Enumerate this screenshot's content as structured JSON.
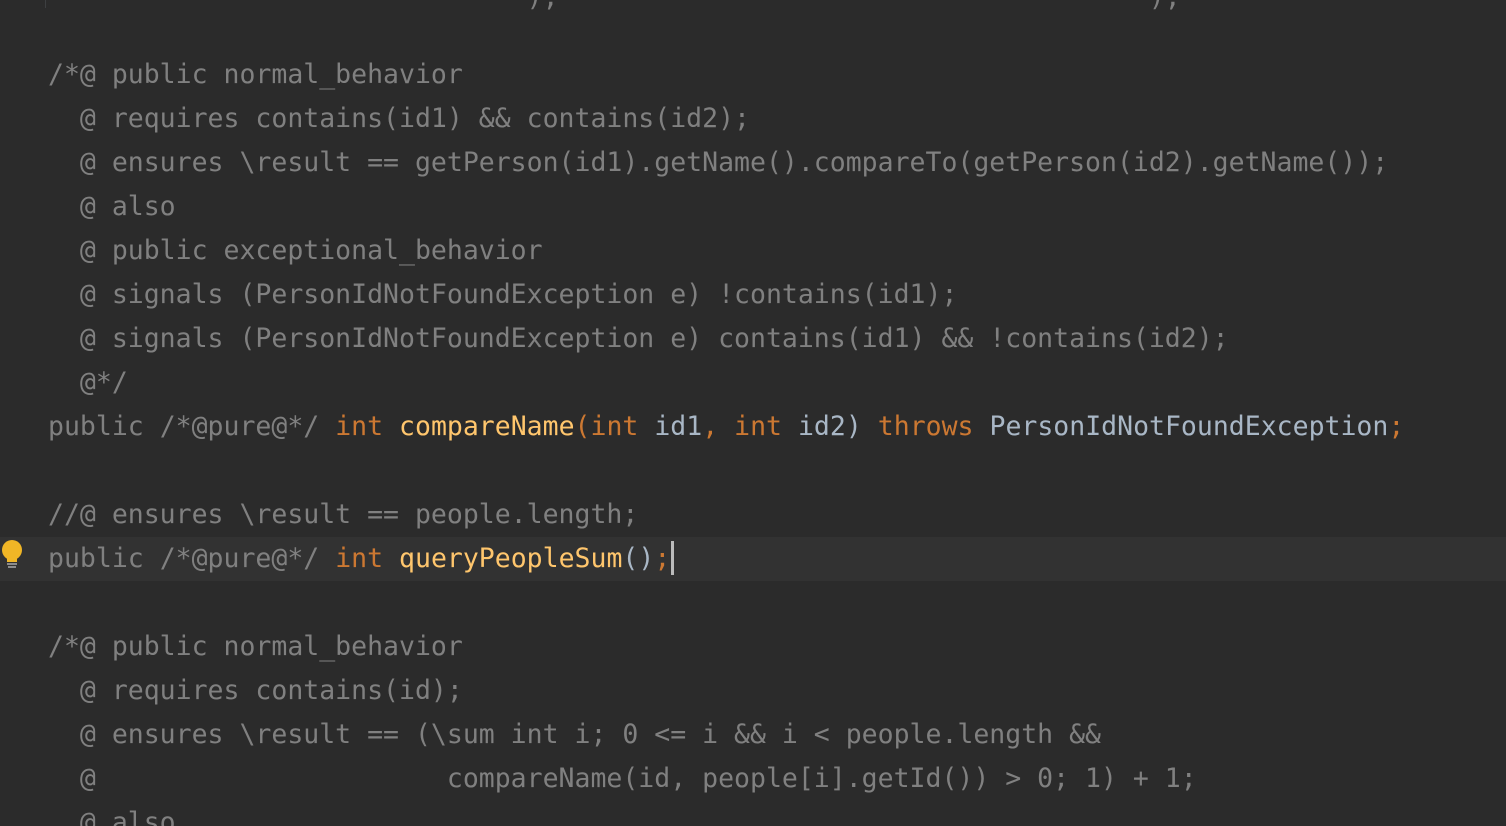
{
  "editor": {
    "top_fragment": "                              );                                     );",
    "lines": {
      "l1": "/*@ public normal_behavior",
      "l2": "  @ requires contains(id1) && contains(id2);",
      "l3": "  @ ensures \\result == getPerson(id1).getName().compareTo(getPerson(id2).getName());",
      "l4": "  @ also",
      "l5": "  @ public exceptional_behavior",
      "l6": "  @ signals (PersonIdNotFoundException e) !contains(id1);",
      "l7": "  @ signals (PersonIdNotFoundException e) contains(id1) && !contains(id2);",
      "l8": "  @*/",
      "l10": "//@ ensures \\result == people.length;",
      "l13": "/*@ public normal_behavior",
      "l14": "  @ requires contains(id);",
      "l15": "  @ ensures \\result == (\\sum int i; 0 <= i && i < people.length &&",
      "l16": "  @                      compareName(id, people[i].getId()) > 0; 1) + 1;",
      "l17": "  @ also"
    },
    "decl1": {
      "public_kw": "public",
      "pure_comment": " /*@pure@*/ ",
      "int_kw": "int",
      "method": "compareName",
      "open_paren": "(",
      "int_kw2": "int",
      "arg1": " id1",
      "comma": ",",
      "int_kw3": "int",
      "arg2": " id2",
      "close_paren": ")",
      "throws_kw": "throws",
      "exception": "PersonIdNotFoundException",
      "semicolon": ";"
    },
    "decl2": {
      "public_kw": "public",
      "pure_comment": " /*@pure@*/ ",
      "int_kw": "int",
      "method": "queryPeopleSum",
      "parens": "()",
      "semicolon": ";"
    },
    "colors": {
      "background": "#2b2b2b",
      "current_line": "#323232",
      "comment": "#808080",
      "keyword": "#cc7832",
      "method": "#ffc66d",
      "identifier": "#a9b7c6",
      "bulb": "#f0b626"
    },
    "icons": {
      "gutter": "lightbulb-icon"
    }
  }
}
